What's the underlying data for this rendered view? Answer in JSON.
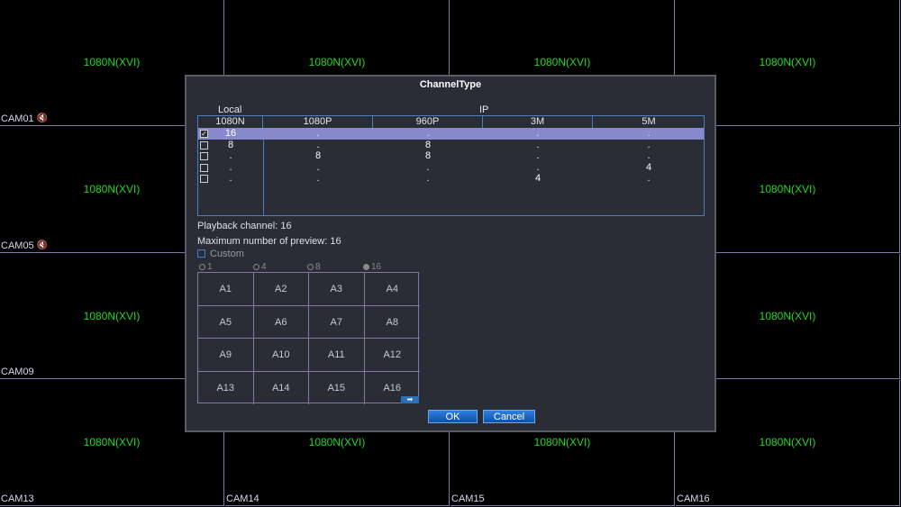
{
  "cameras": [
    {
      "res": "1080N(XVI)",
      "name": "CAM01",
      "icon": "mute-icon"
    },
    {
      "res": "1080N(XVI)",
      "name": "",
      "icon": ""
    },
    {
      "res": "1080N(XVI)",
      "name": "",
      "icon": ""
    },
    {
      "res": "1080N(XVI)",
      "name": "",
      "icon": ""
    },
    {
      "res": "1080N(XVI)",
      "name": "CAM05",
      "icon": "mute-icon"
    },
    {
      "res": "",
      "name": "",
      "icon": ""
    },
    {
      "res": "",
      "name": "",
      "icon": ""
    },
    {
      "res": "1080N(XVI)",
      "name": "",
      "icon": ""
    },
    {
      "res": "1080N(XVI)",
      "name": "CAM09",
      "icon": ""
    },
    {
      "res": "",
      "name": "",
      "icon": ""
    },
    {
      "res": "",
      "name": "",
      "icon": ""
    },
    {
      "res": "1080N(XVI)",
      "name": "",
      "icon": ""
    },
    {
      "res": "1080N(XVI)",
      "name": "CAM13",
      "icon": ""
    },
    {
      "res": "1080N(XVI)",
      "name": "CAM14",
      "icon": ""
    },
    {
      "res": "1080N(XVI)",
      "name": "CAM15",
      "icon": ""
    },
    {
      "res": "1080N(XVI)",
      "name": "CAM16",
      "icon": ""
    }
  ],
  "dialog": {
    "title": "ChannelType",
    "local_label": "Local",
    "ip_label": "IP",
    "columns": [
      "1080N",
      "1080P",
      "960P",
      "3M",
      "5M"
    ],
    "rows": [
      {
        "checked": true,
        "values": [
          "16",
          ".",
          ".",
          ".",
          "."
        ]
      },
      {
        "checked": false,
        "values": [
          "8",
          ".",
          "8",
          ".",
          "."
        ]
      },
      {
        "checked": false,
        "values": [
          ".",
          "8",
          "8",
          ".",
          "."
        ]
      },
      {
        "checked": false,
        "values": [
          ".",
          ".",
          ".",
          ".",
          "4"
        ]
      },
      {
        "checked": false,
        "values": [
          ".",
          ".",
          ".",
          "4",
          "."
        ]
      }
    ],
    "playback_channel": "Playback channel: 16",
    "max_preview": "Maximum number of preview: 16",
    "custom_label": "Custom",
    "radios": [
      {
        "label": "1",
        "selected": false
      },
      {
        "label": "4",
        "selected": false
      },
      {
        "label": "8",
        "selected": false
      },
      {
        "label": "16",
        "selected": true
      }
    ],
    "channels": [
      "A1",
      "A2",
      "A3",
      "A4",
      "A5",
      "A6",
      "A7",
      "A8",
      "A9",
      "A10",
      "A11",
      "A12",
      "A13",
      "A14",
      "A15",
      "A16"
    ],
    "ok_label": "OK",
    "cancel_label": "Cancel"
  },
  "colors": {
    "accent": "#1f6fd0",
    "resolution_text": "#22d822"
  }
}
